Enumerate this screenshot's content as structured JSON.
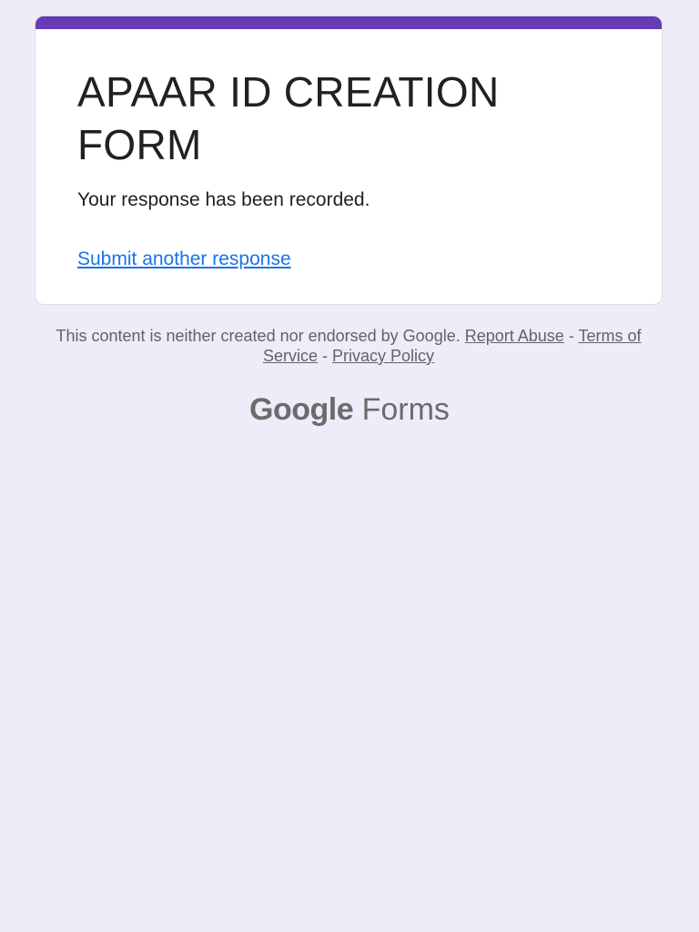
{
  "form": {
    "title": "APAAR ID CREATION FORM",
    "confirmation": "Your response has been recorded.",
    "submit_another_link": "Submit another response"
  },
  "footer": {
    "disclaimer": "This content is neither created nor endorsed by Google.",
    "report_abuse": "Report Abuse",
    "separator": "-",
    "terms": "Terms of Service",
    "privacy": "Privacy Policy"
  },
  "brand": {
    "google": "Google",
    "product": "Forms"
  },
  "colors": {
    "accent": "#673ab7",
    "background": "#f0ebf8",
    "link": "#1a73e8"
  }
}
